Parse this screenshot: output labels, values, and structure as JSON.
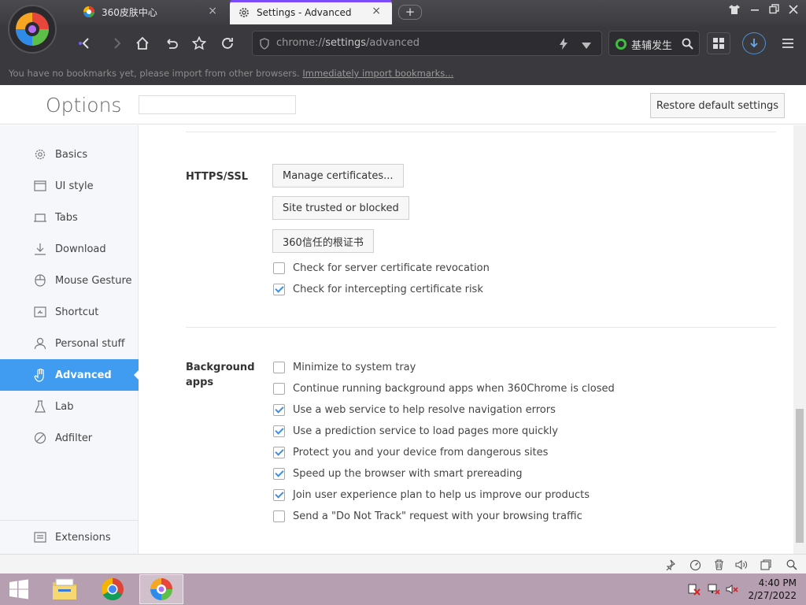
{
  "tabs": [
    {
      "title": "360皮肤中心",
      "close": "×"
    },
    {
      "title": "Settings - Advanced",
      "close": "×"
    }
  ],
  "new_tab_label": "+",
  "address_bar": {
    "scheme": "chrome://",
    "host": "settings",
    "path": "/advanced"
  },
  "search_box": {
    "value": "基辅发生"
  },
  "bookmark_bar": {
    "message": "You have no bookmarks yet, please import from other browsers.",
    "link": "Immediately import bookmarks..."
  },
  "header": {
    "title": "Options",
    "search_placeholder": "",
    "restore_button": "Restore default settings"
  },
  "sidebar": {
    "items": [
      {
        "label": "Basics",
        "icon": "gear-icon"
      },
      {
        "label": "UI style",
        "icon": "window-icon"
      },
      {
        "label": "Tabs",
        "icon": "tab-icon"
      },
      {
        "label": "Download",
        "icon": "download-icon"
      },
      {
        "label": "Mouse Gesture",
        "icon": "mouse-icon"
      },
      {
        "label": "Shortcut",
        "icon": "shortcut-icon"
      },
      {
        "label": "Personal stuff",
        "icon": "user-icon"
      },
      {
        "label": "Advanced",
        "icon": "hand-icon",
        "active": true
      },
      {
        "label": "Lab",
        "icon": "flask-icon"
      },
      {
        "label": "Adfilter",
        "icon": "block-icon"
      }
    ],
    "extensions": {
      "label": "Extensions",
      "icon": "extensions-icon"
    }
  },
  "https_section": {
    "label": "HTTPS/SSL",
    "buttons": [
      "Manage certificates...",
      "Site trusted or blocked",
      "360信任的根证书"
    ],
    "checkboxes": [
      {
        "label": "Check for server certificate revocation",
        "checked": false
      },
      {
        "label": "Check for intercepting certificate risk",
        "checked": true
      }
    ]
  },
  "background_section": {
    "label_line1": "Background",
    "label_line2": "apps",
    "checkboxes": [
      {
        "label": "Minimize to system tray",
        "checked": false
      },
      {
        "label": "Continue running background apps when 360Chrome is closed",
        "checked": false
      },
      {
        "label": "Use a web service to help resolve navigation errors",
        "checked": true
      },
      {
        "label": "Use a prediction service to load pages more quickly",
        "checked": true
      },
      {
        "label": "Protect you and your device from dangerous sites",
        "checked": true
      },
      {
        "label": "Speed up the browser with smart prereading",
        "checked": true
      },
      {
        "label": "Join user experience plan to help us improve our products",
        "checked": true
      },
      {
        "label": "Send a \"Do Not Track\" request with your browsing traffic",
        "checked": false
      }
    ]
  },
  "clock": {
    "time": "4:40 PM",
    "date": "2/27/2022"
  },
  "colors": {
    "accent": "#3f9cf0",
    "toolbar": "#3a3a3e",
    "taskbar": "#b59fb0"
  }
}
